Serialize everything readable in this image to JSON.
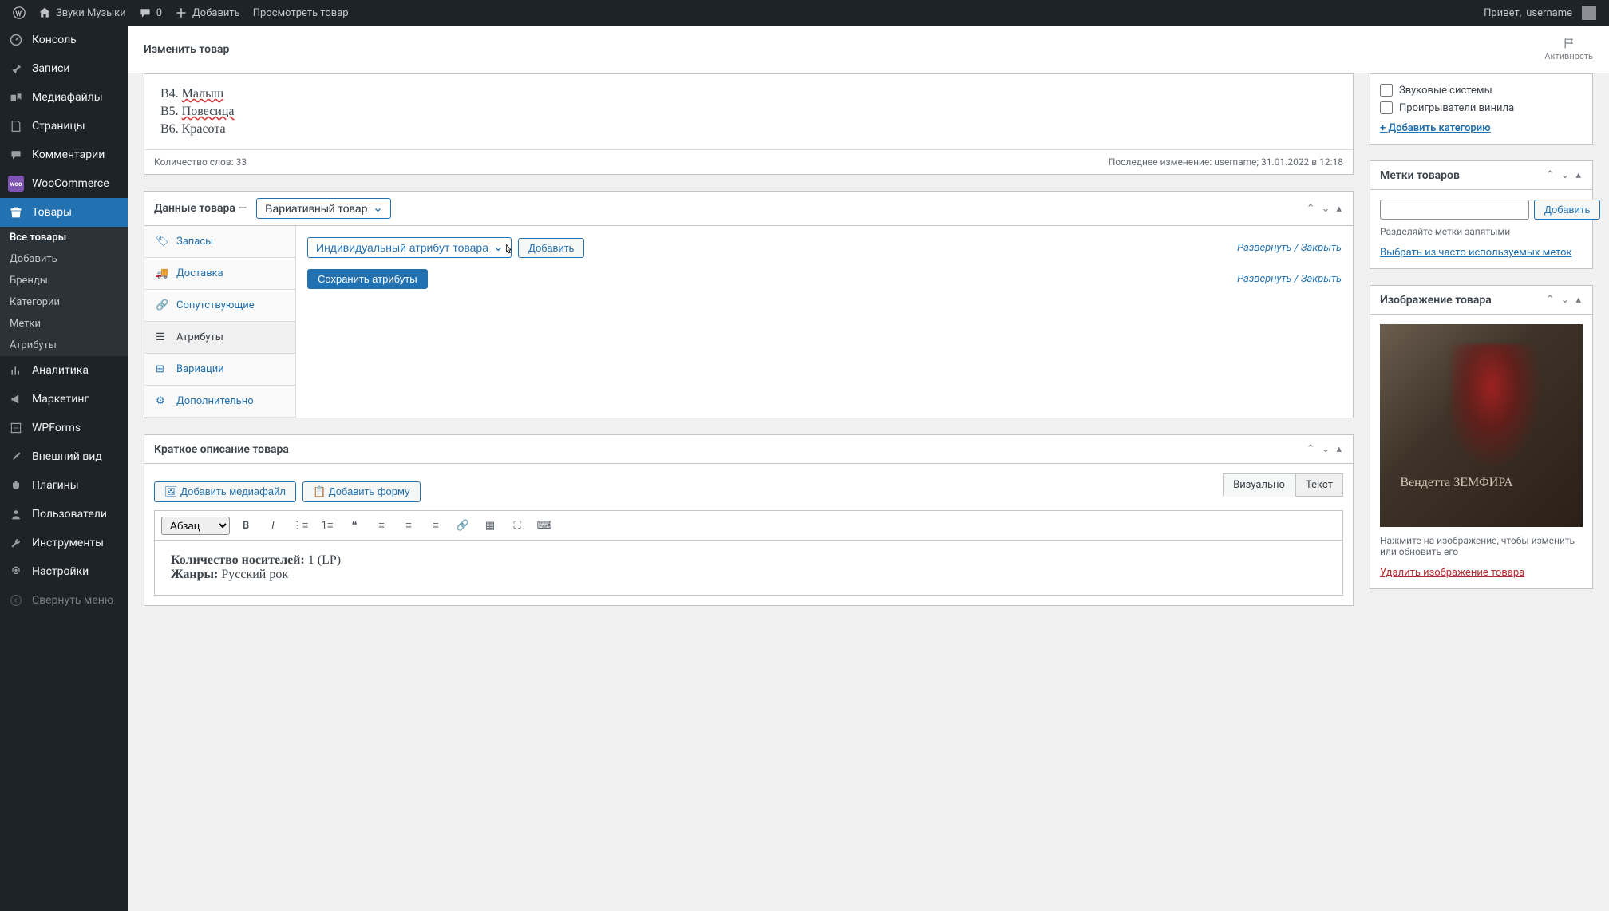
{
  "adminbar": {
    "site_name": "Звуки Музыки",
    "comments_count": "0",
    "new": "Добавить",
    "view_product": "Просмотреть товар",
    "greeting_prefix": "Привет, ",
    "username": "username"
  },
  "sidebar_menu": {
    "dashboard": "Консоль",
    "posts": "Записи",
    "media": "Медиафайлы",
    "pages": "Страницы",
    "comments": "Комментарии",
    "woocommerce": "WooCommerce",
    "products": "Товары",
    "analytics": "Аналитика",
    "marketing": "Маркетинг",
    "wpforms": "WPForms",
    "appearance": "Внешний вид",
    "plugins": "Плагины",
    "users": "Пользователи",
    "tools": "Инструменты",
    "settings": "Настройки",
    "collapse": "Свернуть меню"
  },
  "products_submenu": {
    "all": "Все товары",
    "add": "Добавить",
    "brands": "Бренды",
    "categories": "Категории",
    "tags": "Метки",
    "attributes": "Атрибуты"
  },
  "header": {
    "title": "Изменить товар",
    "activity": "Активность"
  },
  "editor": {
    "lines": {
      "b4": "B4. ",
      "b4_word": "Малыш",
      "b5": "B5. ",
      "b5_word": "Повесица",
      "b6": "B6. Красота"
    },
    "word_count_label": "Количество слов: ",
    "word_count_value": "33",
    "last_edit": "Последнее изменение: username; 31.01.2022 в 12:18"
  },
  "product_data": {
    "title": "Данные товара —",
    "type_select": "Вариативный товар",
    "tabs": {
      "inventory": "Запасы",
      "shipping": "Доставка",
      "linked": "Сопутствующие",
      "attributes": "Атрибуты",
      "variations": "Вариации",
      "advanced": "Дополнительно"
    },
    "attr_select": "Индивидуальный атрибут товара",
    "add_btn": "Добавить",
    "expand_close": "Развернуть / Закрыть",
    "save_attrs": "Сохранить атрибуты"
  },
  "short_desc": {
    "title": "Краткое описание товара",
    "add_media": "Добавить медиафайл",
    "add_form": "Добавить форму",
    "visual_tab": "Визуально",
    "text_tab": "Текст",
    "para_select": "Абзац",
    "line1_label": "Количество носителей: ",
    "line1_val": "1 (LP)",
    "line2_label": "Жанры: ",
    "line2_val": "Русский рок"
  },
  "categories": {
    "sound_systems": "Звуковые системы",
    "vinyl_players": "Проигрыватели винила",
    "add_link": "+ Добавить категорию"
  },
  "tags": {
    "title": "Метки товаров",
    "add_btn": "Добавить",
    "hint": "Разделяйте метки запятыми",
    "choose_link": "Выбрать из часто используемых меток"
  },
  "image": {
    "title": "Изображение товара",
    "hint": "Нажмите на изображение, чтобы изменить или обновить его",
    "remove": "Удалить изображение товара"
  }
}
